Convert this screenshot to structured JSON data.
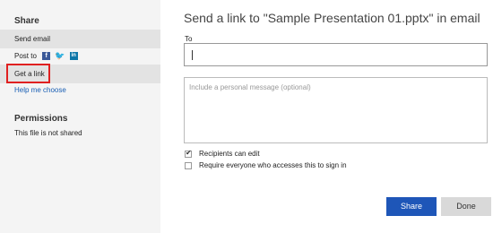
{
  "sidebar": {
    "share_heading": "Share",
    "send_email": "Send email",
    "post_to": "Post to",
    "get_link": "Get a link",
    "help_me_choose": "Help me choose",
    "permissions_heading": "Permissions",
    "permissions_status": "This file is not shared"
  },
  "main": {
    "title": "Send a link to \"Sample Presentation 01.pptx\" in email",
    "to_label": "To",
    "to_value": "",
    "message_placeholder": "Include a personal message (optional)",
    "recipients_can_edit": "Recipients can edit",
    "recipients_can_edit_checked": true,
    "require_sign_in": "Require everyone who accesses this to sign in",
    "require_sign_in_checked": false
  },
  "buttons": {
    "share": "Share",
    "done": "Done"
  },
  "colors": {
    "sidebar_bg": "#f4f4f4",
    "accent": "#1e56b8",
    "link": "#1a5fb4",
    "highlight": "#e02020"
  },
  "icons": [
    "facebook-icon",
    "twitter-icon",
    "linkedin-icon",
    "checkmark-icon"
  ]
}
